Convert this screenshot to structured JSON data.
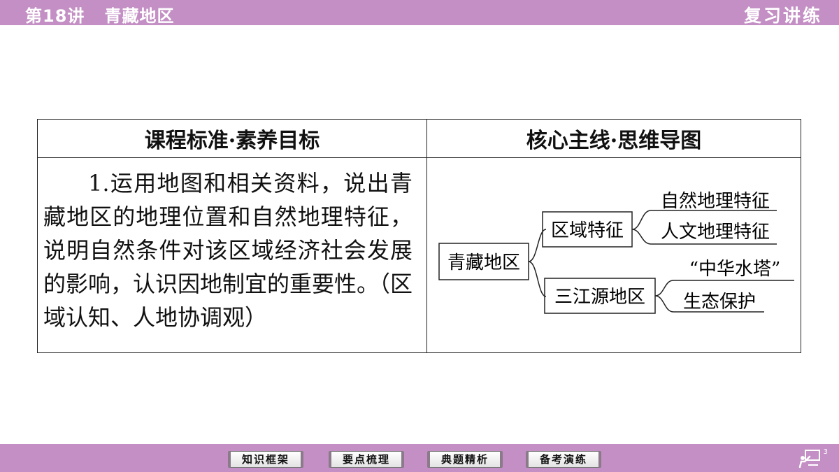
{
  "header": {
    "lesson": "第18讲   青藏地区",
    "section": "复习讲练"
  },
  "table": {
    "col1_header": "课程标准·素养目标",
    "col2_header": "核心主线·思维导图",
    "standard_text": "1.运用地图和相关资料，说出青藏地区的地理位置和自然地理特征，说明自然条件对该区域经济社会发展的影响，认识因地制宜的重要性。（区域认知、人地协调观）"
  },
  "mindmap": {
    "root": "青藏地区",
    "branch1": "区域特征",
    "branch1_leaf1": "自然地理特征",
    "branch1_leaf2": "人文地理特征",
    "branch2": "三江源地区",
    "branch2_leaf1": "“中华水塔”",
    "branch2_leaf2": "生态保护"
  },
  "nav": {
    "btn1": "知识框架",
    "btn2": "要点梳理",
    "btn3": "典题精析",
    "btn4": "备考演练"
  },
  "footer": {
    "page_number": "3"
  }
}
